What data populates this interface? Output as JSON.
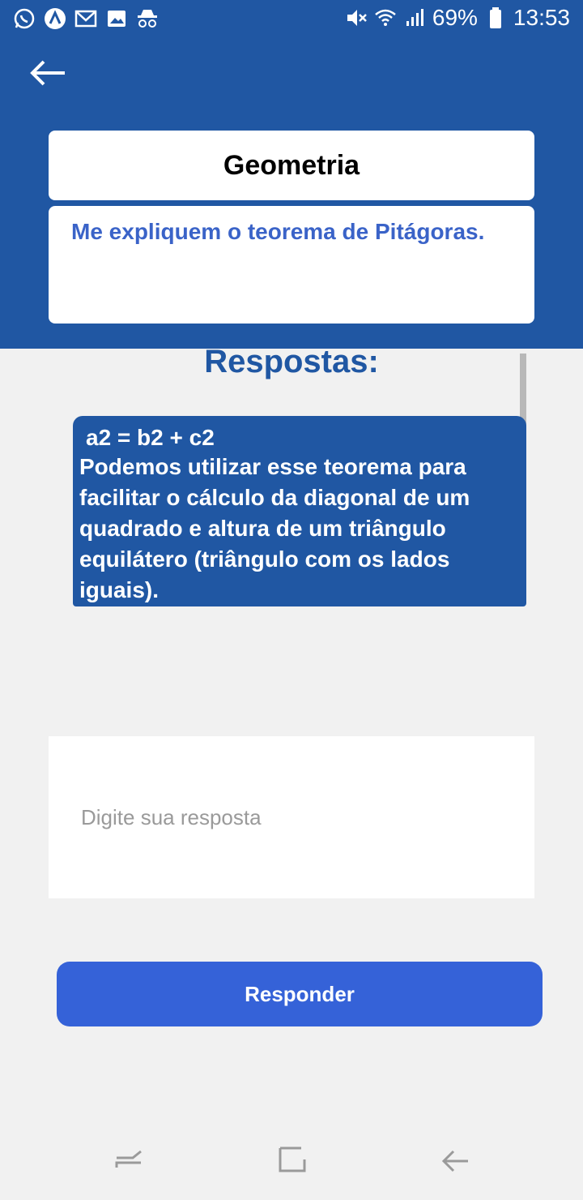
{
  "status_bar": {
    "left_icons": [
      "whatsapp-icon",
      "vpn-icon",
      "gmail-icon",
      "gallery-icon",
      "incognito-icon"
    ],
    "battery_percent": "69%",
    "time": "13:53"
  },
  "header": {
    "background_color": "#2057a3",
    "category": "Geometria",
    "question": "Me expliquem o teorema de Pitágoras."
  },
  "answers": {
    "heading": "Respostas:",
    "items": [
      {
        "formula": "a2 = b2 + c2",
        "text": "Podemos utilizar esse teorema para facilitar o cálculo da diagonal de um quadrado e altura de um triângulo equilátero (triângulo com os lados iguais)."
      }
    ]
  },
  "reply": {
    "placeholder": "Digite sua resposta",
    "button_label": "Responder",
    "button_color": "#3562d8"
  },
  "nav_bar": {
    "items": [
      "recent-apps-icon",
      "home-icon",
      "back-nav-icon"
    ]
  }
}
